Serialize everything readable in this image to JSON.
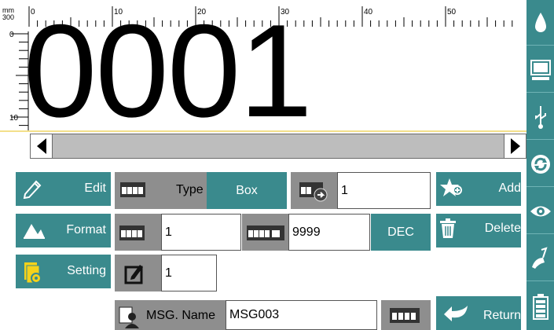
{
  "ruler": {
    "unit_top": "mm",
    "unit_bottom": "300",
    "h_labels": [
      "0",
      "10",
      "20",
      "30",
      "40",
      "50"
    ],
    "v_labels": [
      "0",
      "10"
    ]
  },
  "canvas": {
    "counter_text": "0001"
  },
  "left_buttons": {
    "edit": "Edit",
    "format": "Format",
    "setting": "Setting"
  },
  "row1": {
    "type_label": "Type",
    "type_value": "Box",
    "count_value": "1"
  },
  "row2": {
    "start_value": "1",
    "end_value": "9999",
    "mode_label": "DEC"
  },
  "row3": {
    "step_value": "1"
  },
  "row4": {
    "msg_name_label": "MSG. Name",
    "msg_name_value": "MSG003"
  },
  "right_buttons": {
    "add": "Add",
    "delete": "Delete",
    "return": "Return"
  },
  "colors": {
    "accent": "#3a8a8d",
    "panel_gray": "#8e8e8e",
    "scroll": "#bdbdbd"
  },
  "sidebar_icons": [
    "ink-drop-icon",
    "monitor-icon",
    "usb-icon",
    "refresh-icon",
    "eye-icon",
    "cleaning-brush-icon",
    "battery-icon"
  ]
}
